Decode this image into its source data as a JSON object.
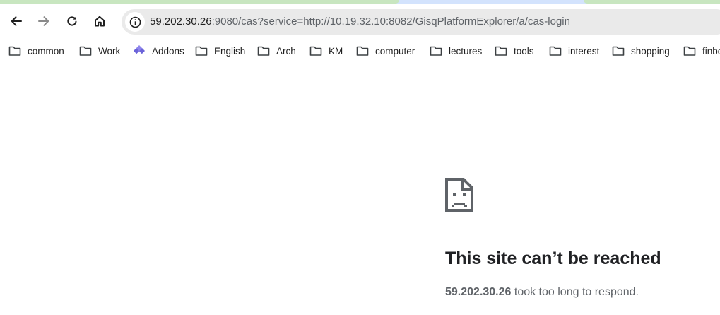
{
  "tab_colors": {
    "active_group": "#c8e6c0",
    "strip": "#d3e3fd"
  },
  "toolbar": {
    "back_icon": "arrow-left-icon",
    "forward_icon": "arrow-right-icon",
    "reload_icon": "reload-icon",
    "home_icon": "home-icon"
  },
  "omnibox": {
    "site_info_icon": "info-icon",
    "host": "59.202.30.26",
    "rest": ":9080/cas?service=http://10.19.32.10:8082/GisqPlatformExplorer/a/cas-login"
  },
  "bookmarks": [
    {
      "label": "common",
      "icon": "folder-icon"
    },
    {
      "label": "Work",
      "icon": "folder-icon"
    },
    {
      "label": "Addons",
      "icon": "addons-icon"
    },
    {
      "label": "English",
      "icon": "folder-icon"
    },
    {
      "label": "Arch",
      "icon": "folder-icon"
    },
    {
      "label": "KM",
      "icon": "folder-icon"
    },
    {
      "label": "computer",
      "icon": "folder-icon"
    },
    {
      "label": "lectures",
      "icon": "folder-icon"
    },
    {
      "label": "tools",
      "icon": "folder-icon"
    },
    {
      "label": "interest",
      "icon": "folder-icon"
    },
    {
      "label": "shopping",
      "icon": "folder-icon"
    },
    {
      "label": "finbo",
      "icon": "folder-icon"
    }
  ],
  "error": {
    "icon": "sad-page-icon",
    "title": "This site can’t be reached",
    "host": "59.202.30.26",
    "message": " took too long to respond."
  }
}
